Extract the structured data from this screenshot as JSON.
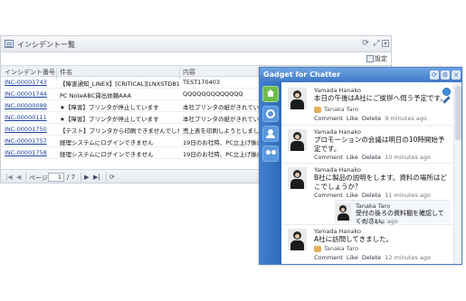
{
  "incident_panel": {
    "title": "インシデント一覧",
    "settings_label": "設定",
    "header_icons": [
      "refresh-icon",
      "expand-icon",
      "collapse-icon"
    ],
    "columns": [
      "インシデント番号",
      "件名",
      "内容"
    ],
    "rows": [
      {
        "id": "INC-00001743",
        "name": "【障害通知_LINEX】[CRITICAL][LNXSTDB1]障…",
        "content": "TEST170403"
      },
      {
        "id": "INC-00001744",
        "name": "PC NoteABC貸出依頼AAA",
        "content": "QQQQQQQQQQQQQ"
      },
      {
        "id": "INC-00000099",
        "name": "★【障害】プリンタが停止しています",
        "content": "本社プリンタの紙がきれていま…"
      },
      {
        "id": "INC-00000111",
        "name": "★【障害】プリンタが停止しています",
        "content": "本社プリンタの紙がきれていま…"
      },
      {
        "id": "INC-00001750",
        "name": "【テスト】プリンタから印刷できませんでした",
        "content": "売上表を印刷しようとしました…"
      },
      {
        "id": "INC-00001757",
        "name": "経理システムにログインできません",
        "content": "19日のお社時、PC立上げ後に…"
      },
      {
        "id": "INC-00001758",
        "name": "経理システムにログインできません",
        "content": "19日のお社時、PC立上げ後に…"
      }
    ],
    "pager": {
      "page_label": "ページ",
      "current_page": "1",
      "total_pages": "/ 7"
    }
  },
  "chatter_gadget": {
    "title": "Gadget for Chatter",
    "sidebar_icons": [
      "home-icon",
      "profile-icon",
      "group-icon",
      "people-icon"
    ],
    "posts": [
      {
        "author": "Yamada Hanako",
        "text": "本日の午後はA社にご挨拶へ伺う予定です。",
        "likes": "Tanaka Taro",
        "actions": [
          "Comment",
          "Like",
          "Delete"
        ],
        "time": "9 minutes ago"
      },
      {
        "author": "Yamada Hanako",
        "text": "プロモーションの会議は明日の10時開始予定です。",
        "likes": "",
        "actions": [
          "Comment",
          "Like",
          "Delete"
        ],
        "time": "10 minutes ago"
      },
      {
        "author": "Yamada Hanako",
        "text": "B社に製品の説明をします。資料の場所はどこでしょうか？",
        "likes": "",
        "actions": [
          "Comment",
          "Like",
          "Delete"
        ],
        "time": "11 minutes ago",
        "reply": {
          "author": "Tanaka Taro",
          "text": "受付の後ろの資料棚を確認してください。",
          "time": "7 minutes ago"
        }
      },
      {
        "author": "Yamada Hanako",
        "text": "A社に訪問してきました。",
        "likes": "Tanaka Taro",
        "actions": [
          "Comment",
          "Like",
          "Delete"
        ],
        "time": "12 minutes ago"
      }
    ]
  }
}
